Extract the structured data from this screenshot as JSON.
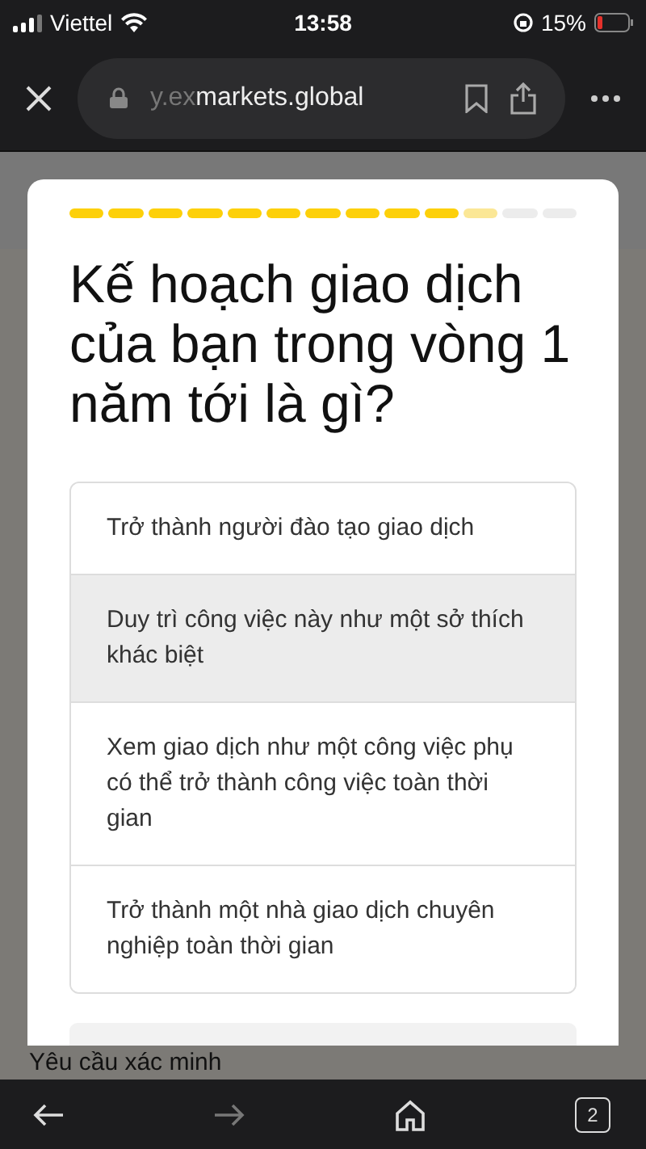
{
  "status_bar": {
    "carrier": "Viettel",
    "time": "13:58",
    "battery": "15%"
  },
  "address_bar": {
    "url_faded": "y.ex",
    "url": "markets.global"
  },
  "progress": [
    {
      "done": true,
      "current": false
    },
    {
      "done": true,
      "current": false
    },
    {
      "done": true,
      "current": false
    },
    {
      "done": true,
      "current": false
    },
    {
      "done": true,
      "current": false
    },
    {
      "done": true,
      "current": false
    },
    {
      "done": true,
      "current": false
    },
    {
      "done": true,
      "current": false
    },
    {
      "done": true,
      "current": false
    },
    {
      "done": true,
      "current": false
    },
    {
      "done": false,
      "current": true
    },
    {
      "done": false,
      "current": false
    },
    {
      "done": false,
      "current": false
    }
  ],
  "question": "Kế hoạch giao dịch của bạn trong vòng 1 năm tới là gì?",
  "options": [
    {
      "label": "Trở thành người đào tạo giao dịch",
      "selected": false
    },
    {
      "label": "Duy trì công việc này như một sở thích khác biệt",
      "selected": true
    },
    {
      "label": "Xem giao dịch như một công việc phụ có thể trở thành công việc toàn thời gian",
      "selected": false
    },
    {
      "label": "Trở thành một nhà giao dịch chuyên nghiệp toàn thời gian",
      "selected": false
    }
  ],
  "page_heading": "Yêu cầu xác minh",
  "toolbar": [
    {
      "kind": "back",
      "disabled": false
    },
    {
      "kind": "forward",
      "disabled": true
    },
    {
      "kind": "home",
      "disabled": false
    },
    {
      "kind": "tabs",
      "disabled": false,
      "label": "2"
    }
  ]
}
